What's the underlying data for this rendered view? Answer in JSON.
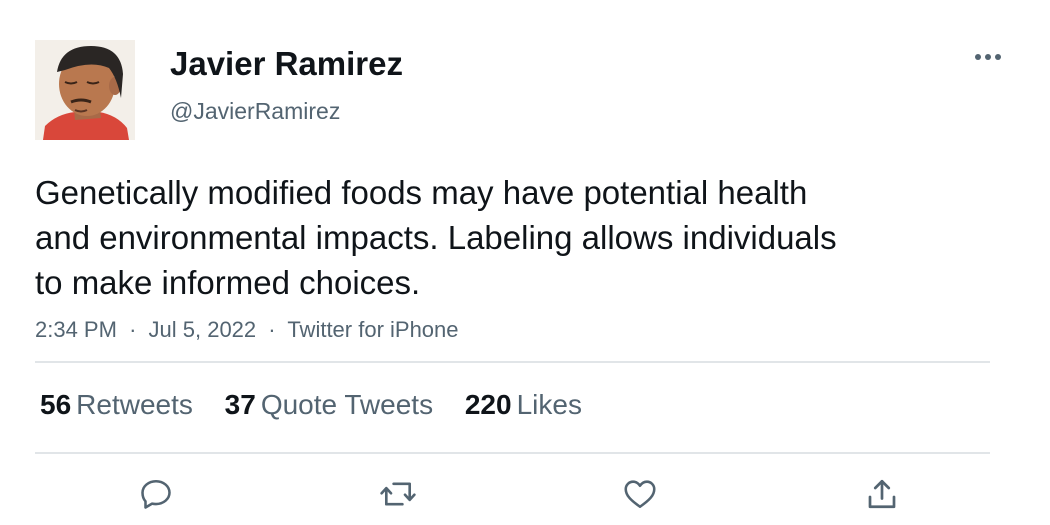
{
  "author": {
    "display_name": "Javier Ramirez",
    "handle": "@JavierRamirez"
  },
  "tweet": {
    "text_lines": [
      "Genetically modified foods may have potential health",
      "and environmental impacts. Labeling allows individuals",
      "to make informed choices."
    ],
    "time": "2:34 PM",
    "date": "Jul 5, 2022",
    "source": "Twitter for iPhone",
    "separator": "·"
  },
  "stats": {
    "retweets": {
      "count": "56",
      "label": "Retweets"
    },
    "quotes": {
      "count": "37",
      "label": "Quote Tweets"
    },
    "likes": {
      "count": "220",
      "label": "Likes"
    }
  },
  "icons": {
    "more": "more-horizontal-icon",
    "reply": "reply-icon",
    "retweet": "retweet-icon",
    "like": "heart-icon",
    "share": "share-icon"
  },
  "colors": {
    "text": "#0f1419",
    "secondary": "#536471",
    "divider": "#e1e5e8"
  }
}
